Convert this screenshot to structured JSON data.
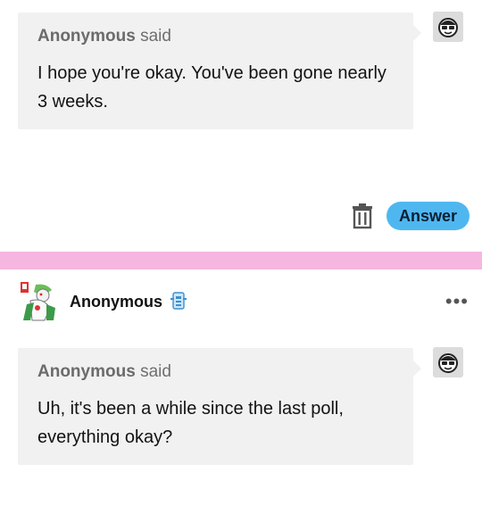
{
  "posts": [
    {
      "asker_name": "Anonymous",
      "said": "said",
      "question": "I hope you're okay. You've been gone nearly 3 weeks.",
      "answer_label": "Answer"
    },
    {
      "author": "Anonymous",
      "asker_name": "Anonymous",
      "said": "said",
      "question": "Uh, it's been a while since the last poll, everything okay?"
    }
  ],
  "icons": {
    "asker_avatar": "sunglasses-face-icon",
    "delete": "trash-icon",
    "more": "more-options-icon",
    "badge": "blue-badge-icon"
  },
  "colors": {
    "divider": "#f5b6e0",
    "answer_button": "#4fb7f0",
    "bubble": "#f1f1f1"
  }
}
